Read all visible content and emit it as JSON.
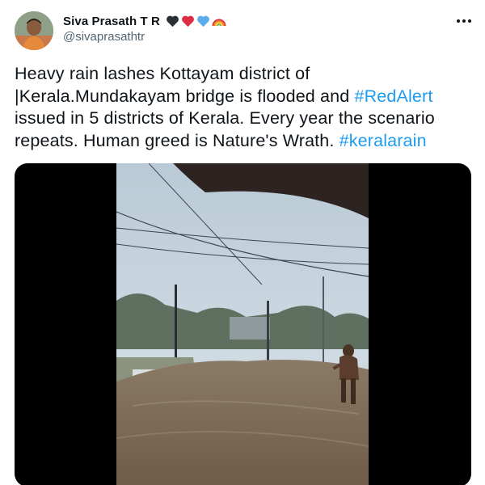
{
  "author": {
    "display_name": "Siva Prasath T R",
    "handle": "@sivaprasathtr",
    "name_emojis": [
      "black-heart-icon",
      "red-heart-icon",
      "blue-heart-icon",
      "rainbow-icon"
    ]
  },
  "tweet": {
    "text_parts": [
      {
        "text": "Heavy rain lashes Kottayam district of |Kerala.Mundakayam bridge is flooded and ",
        "type": "text"
      },
      {
        "text": "#RedAlert",
        "type": "hashtag"
      },
      {
        "text": " issued in 5 districts of Kerala. Every year the scenario repeats. Human greed is Nature's Wrath. ",
        "type": "text"
      },
      {
        "text": "#keralarain",
        "type": "hashtag"
      }
    ]
  },
  "media": {
    "type": "video",
    "description_icon": "flooded-bridge-video-frame"
  },
  "colors": {
    "accent": "#1d9bf0",
    "handle": "#536471",
    "text": "#0f1419"
  }
}
